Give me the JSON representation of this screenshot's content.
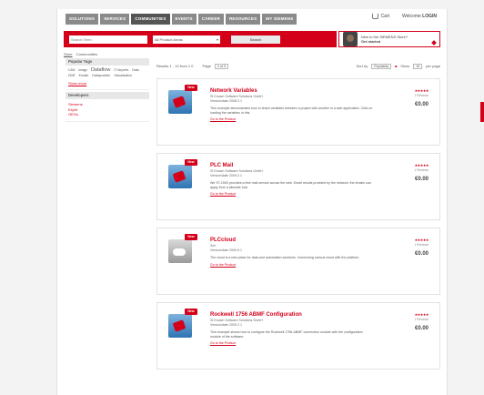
{
  "nav": {
    "tabs": [
      "SOLUTIONS",
      "SERVICES",
      "COMMUNITIES",
      "EVENTS",
      "CAREER",
      "RESOURCES",
      "MY SIEMENS"
    ],
    "active_index": 2,
    "cart_label": "Cart",
    "login_prefix": "Welcome",
    "login_label": "LOGIN"
  },
  "search": {
    "input_placeholder": "Search Term",
    "category_value": "All Product Areas",
    "button_label": "Search"
  },
  "promo": {
    "line1": "New to the SIEMENS Store?",
    "line2": "Get started"
  },
  "breadcrumb": [
    "Store",
    "Communities"
  ],
  "sidebar": {
    "popular_title": "Popular Tags",
    "tags": [
      {
        "t": "CAN",
        "s": "small"
      },
      {
        "t": "image",
        "s": "small"
      },
      {
        "t": "Dataflow",
        "s": "big"
      },
      {
        "t": "IT Airports",
        "s": "small"
      },
      {
        "t": "Data",
        "s": "small"
      },
      {
        "t": "DDR",
        "s": "small"
      },
      {
        "t": "Ecolab",
        "s": "small"
      },
      {
        "t": "Dataprovider",
        "s": "small"
      },
      {
        "t": "Visualization",
        "s": "small"
      }
    ],
    "more_label": "Show more",
    "developers_title": "Developers",
    "developers": [
      "Siemens",
      "Esprit",
      "OEGs"
    ]
  },
  "toolbar": {
    "results_label": "Results 1 - 10 from 1 0",
    "page_label": "Page",
    "page_value": "1 of 3",
    "sort_label": "Sort by",
    "sort_value": "Popularity",
    "show_label": "Show",
    "show_value": "10",
    "per_page_label": "per page"
  },
  "products": [
    {
      "badge": "New",
      "title": "Network Variables",
      "vendor": "SI Known Software Solutions GmbH",
      "version_label": "Version/date 2008.2.1",
      "description": "This example demonstrates how to share variables between a project with another in a web application. Click on loading the variables in this.",
      "link": "Go to the Product",
      "stars": "★★★★★",
      "reviews": "1 Reviews",
      "price": "€0.00",
      "icon": "network-variables-icon",
      "grey": false
    },
    {
      "badge": "New",
      "title": "PLC Mail",
      "vendor": "SI Known Software Solutions GmbH",
      "version_label": "Version/date 2009.2.1",
      "description": "We S7-1500 provides a free mail service across the web. Email results provided by the network, the emails can apply from a sitewide hub.",
      "link": "Go to the Product",
      "stars": "★★★★★",
      "reviews": "1 Reviews",
      "price": "€0.00",
      "icon": "plc-mail-icon",
      "grey": false
    },
    {
      "badge": "New",
      "title": "PLCcloud",
      "vendor": "S/m",
      "version_label": "Version/date 2009.9.1",
      "description": "The cloud is a new place for data and automation solutions. Connecting various cloud with the platform.",
      "link": "Go to the Product",
      "stars": "★★★★★",
      "reviews": "1 Reviews",
      "price": "€0.00",
      "icon": "plc-cloud-icon",
      "grey": true
    },
    {
      "badge": "New",
      "title": "Rockwell 1756 ABMF Configuration",
      "vendor": "SI Known Software Solutions GmbH",
      "version_label": "Version/date 2009.2.1",
      "description": "This example shows how to configure the Rockwell 1756-ABMF connection module with the configuration module of the software.",
      "link": "Go to the Product",
      "stars": "★★★★★",
      "reviews": "1 Reviews",
      "price": "€0.00",
      "icon": "rockwell-config-icon",
      "grey": false
    }
  ]
}
